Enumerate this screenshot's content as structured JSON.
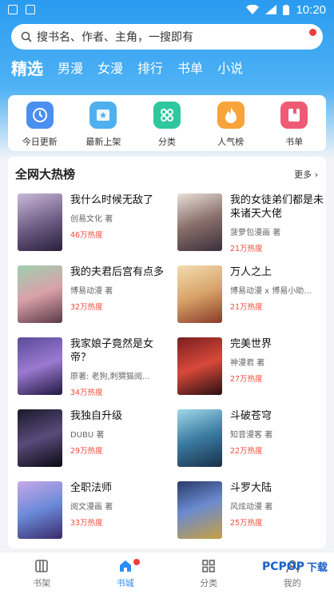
{
  "status_bar": {
    "time": "10:20"
  },
  "search": {
    "placeholder": "搜书名、作者、主角，一搜即有"
  },
  "tabs": [
    {
      "label": "精选",
      "active": true
    },
    {
      "label": "男漫"
    },
    {
      "label": "女漫"
    },
    {
      "label": "排行"
    },
    {
      "label": "书单"
    },
    {
      "label": "小说"
    }
  ],
  "categories": [
    {
      "label": "今日更新",
      "icon": "clock-icon",
      "color": "#4b8ff0"
    },
    {
      "label": "最新上架",
      "icon": "star-icon",
      "color": "#4fb0f0"
    },
    {
      "label": "分类",
      "icon": "grid-icon",
      "color": "#2ec7a0"
    },
    {
      "label": "人气榜",
      "icon": "fire-icon",
      "color": "#f7a43a"
    },
    {
      "label": "书单",
      "icon": "bookmark-icon",
      "color": "#ef5b74"
    }
  ],
  "hot_section": {
    "title": "全网大热榜",
    "more_label": "更多",
    "items": [
      {
        "title": "我什么时候无敌了",
        "author": "创易文化 著",
        "heat": "46万热度"
      },
      {
        "title": "我的女徒弟们都是未来诸天大佬",
        "author": "菠萝包漫画 著",
        "heat": "21万热度"
      },
      {
        "title": "我的夫君后宫有点多",
        "author": "博易动漫 著",
        "heat": "32万热度"
      },
      {
        "title": "万人之上",
        "author": "博易动漫 x 博易小助...",
        "heat": "21万热度"
      },
      {
        "title": "我家娘子竟然是女帝？",
        "author": "原著: 老狗,刺猬猫阅...",
        "heat": "34万热度"
      },
      {
        "title": "完美世界",
        "author": "神漫君 著",
        "heat": "27万热度"
      },
      {
        "title": "我独自升级",
        "author": "DUBU 著",
        "heat": "29万热度"
      },
      {
        "title": "斗破苍穹",
        "author": "知音漫客 著",
        "heat": "22万热度"
      },
      {
        "title": "全职法师",
        "author": "阅文漫画 著",
        "heat": "33万热度"
      },
      {
        "title": "斗罗大陆",
        "author": "风炫动漫 著",
        "heat": "25万热度"
      }
    ]
  },
  "bottom_nav": [
    {
      "label": "书架",
      "icon": "bookshelf-icon"
    },
    {
      "label": "书城",
      "icon": "home-icon",
      "active": true
    },
    {
      "label": "分类",
      "icon": "category-icon"
    },
    {
      "label": "我的",
      "icon": "profile-icon"
    }
  ],
  "watermark": {
    "logo": "PCPOP",
    "text": "下载"
  }
}
